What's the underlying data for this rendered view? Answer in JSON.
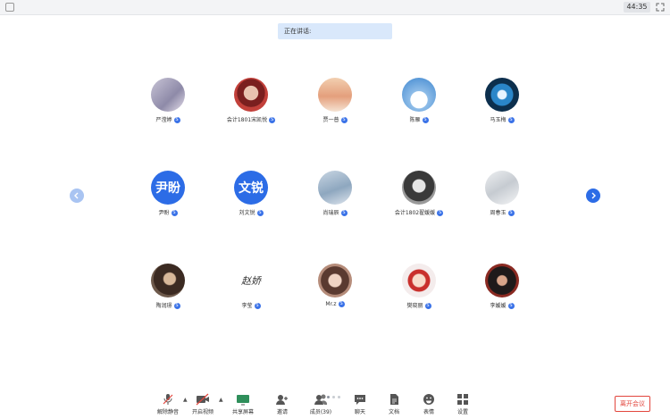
{
  "topbar": {
    "timer": "44:35"
  },
  "speaking_label": "正在讲话:",
  "participants": [
    {
      "name": "严滢婷",
      "avatar_text": ""
    },
    {
      "name": "会计1801宋凯悦",
      "avatar_text": ""
    },
    {
      "name": "贾一普",
      "avatar_text": ""
    },
    {
      "name": "陈雁",
      "avatar_text": ""
    },
    {
      "name": "马玉梅",
      "avatar_text": ""
    },
    {
      "name": "尹盼",
      "avatar_text": "尹盼"
    },
    {
      "name": "刘文锐",
      "avatar_text": "文锐"
    },
    {
      "name": "尚瑞辰",
      "avatar_text": ""
    },
    {
      "name": "会计1802翟媛媛",
      "avatar_text": ""
    },
    {
      "name": "周春玉",
      "avatar_text": ""
    },
    {
      "name": "陶润璟",
      "avatar_text": ""
    },
    {
      "name": "李莹",
      "avatar_text": "赵娇"
    },
    {
      "name": "Mr.z",
      "avatar_text": ""
    },
    {
      "name": "樊晓丽",
      "avatar_text": ""
    },
    {
      "name": "李媛媛",
      "avatar_text": ""
    }
  ],
  "host_mark": "S",
  "toolbar": {
    "unmute": "解除静音",
    "start_video": "开启视频",
    "share_screen": "共享屏幕",
    "invite": "邀请",
    "members": "成员(39)",
    "chat": "聊天",
    "docs": "文档",
    "reactions": "表情",
    "settings": "设置"
  },
  "leave_button": "离开会议",
  "colors": {
    "accent": "#2c6ce6",
    "danger": "#e2463d",
    "speaking_bg": "#d9e8fb"
  }
}
